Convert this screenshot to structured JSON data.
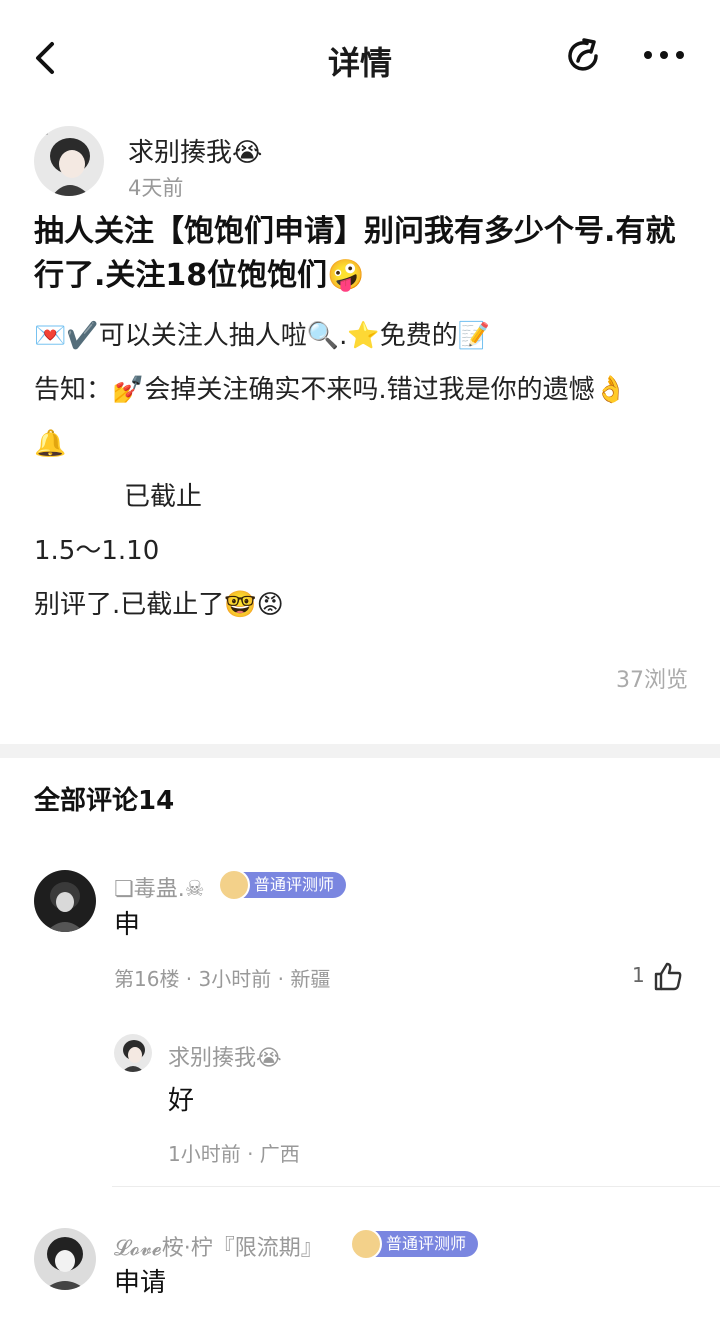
{
  "header": {
    "title": "详情",
    "icons": {
      "back": "chevron-left-icon",
      "share": "share-icon",
      "more": "more-icon"
    }
  },
  "post": {
    "author_name": "求别揍我😭",
    "time": "4天前",
    "title": "抽人关注【饱饱们申请】别问我有多少个号.有就行了.关注18位饱饱们🤪",
    "lines": [
      "💌✔️可以关注人抽人啦🔍.⭐免费的📝",
      "告知：💅会掉关注确实不来吗.错过我是你的遗憾👌",
      "🔔",
      "已截止",
      "1.5～1.10",
      "别评了.已截止了🤓😡"
    ],
    "views": "37浏览"
  },
  "comments_header": "全部评论14",
  "comments": [
    {
      "name": "❏毒蛊.☠",
      "badge": "普通评测师",
      "text": "申",
      "meta": "第16楼 · 3小时前 · 新疆",
      "likes": "1"
    },
    {
      "name": "𝓛𝓸𝓿𝓮桉·柠『限流期』",
      "badge": "普通评测师",
      "text": "申请"
    }
  ],
  "reply": {
    "name": "求别揍我😭",
    "text": "好",
    "meta": "1小时前 · 广西"
  },
  "colors": {
    "badge": "#7a86e0",
    "muted": "#999999",
    "divider": "#f2f2f2"
  }
}
